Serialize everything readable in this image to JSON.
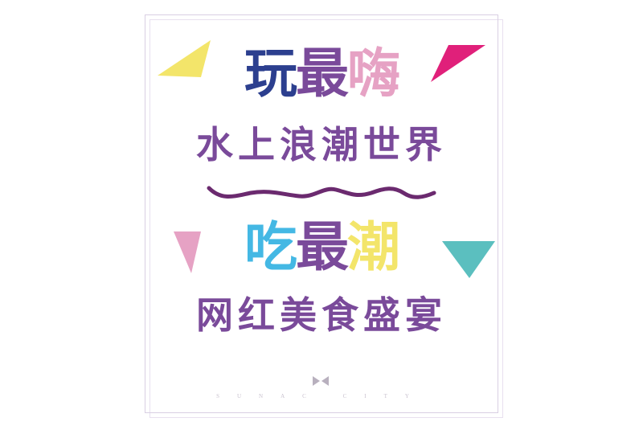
{
  "headline_top": {
    "char1": "玩",
    "char2": "最",
    "char3": "嗨"
  },
  "subline_top": "水上浪潮世界",
  "headline_bottom": {
    "char1": "吃",
    "char2": "最",
    "char3": "潮"
  },
  "subline_bottom": "网红美食盛宴",
  "footer": {
    "brand": "SUNAC CITY"
  },
  "colors": {
    "blue": "#2c3f8f",
    "purple": "#7a4a9a",
    "pink": "#e6a2c4",
    "sky": "#44b8e4",
    "yellow": "#f3e56a",
    "magenta": "#e0207a",
    "teal": "#5bbfbf"
  }
}
